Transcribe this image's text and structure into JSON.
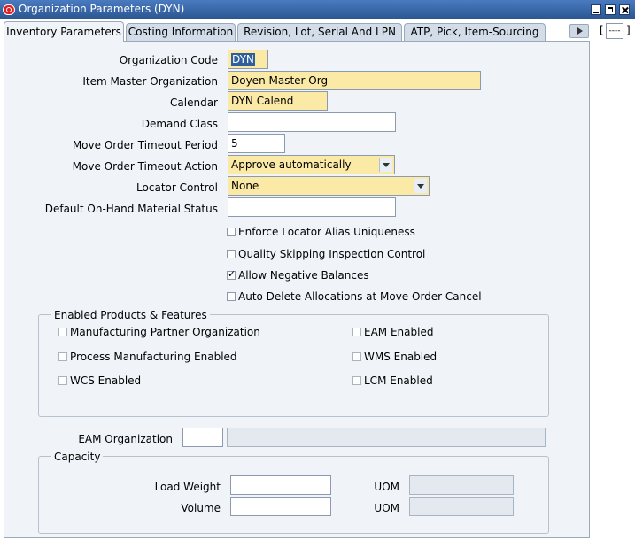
{
  "window": {
    "title": "Organization Parameters (DYN)"
  },
  "tabs": [
    {
      "label": "Inventory Parameters"
    },
    {
      "label": "Costing Information"
    },
    {
      "label": "Revision, Lot, Serial And LPN"
    },
    {
      "label": "ATP, Pick, Item-Sourcing"
    }
  ],
  "tab_extra_field": "----",
  "form": {
    "organization_code": {
      "label": "Organization Code",
      "value": "DYN"
    },
    "item_master_org": {
      "label": "Item Master Organization",
      "value": "Doyen Master Org"
    },
    "calendar": {
      "label": "Calendar",
      "value": "DYN Calend"
    },
    "demand_class": {
      "label": "Demand Class",
      "value": ""
    },
    "move_order_timeout_period": {
      "label": "Move Order Timeout Period",
      "value": "5"
    },
    "move_order_timeout_action": {
      "label": "Move Order Timeout Action",
      "value": "Approve automatically"
    },
    "locator_control": {
      "label": "Locator Control",
      "value": "None"
    },
    "default_onhand_status": {
      "label": "Default On-Hand Material Status",
      "value": ""
    }
  },
  "checkboxes": [
    {
      "label": "Enforce Locator Alias Uniqueness",
      "checked": false
    },
    {
      "label": "Quality Skipping Inspection Control",
      "checked": false
    },
    {
      "label": "Allow Negative Balances",
      "checked": true
    },
    {
      "label": "Auto Delete Allocations at Move Order Cancel",
      "checked": false
    }
  ],
  "enabled_products": {
    "title": "Enabled Products & Features",
    "items": [
      {
        "label": "Manufacturing Partner Organization",
        "checked": false
      },
      {
        "label": "EAM Enabled",
        "checked": false
      },
      {
        "label": "Process Manufacturing Enabled",
        "checked": false
      },
      {
        "label": "WMS Enabled",
        "checked": false
      },
      {
        "label": "WCS Enabled",
        "checked": false
      },
      {
        "label": "LCM Enabled",
        "checked": false
      }
    ]
  },
  "eam": {
    "label": "EAM Organization",
    "code": "",
    "name": ""
  },
  "capacity": {
    "title": "Capacity",
    "load_weight_label": "Load Weight",
    "load_weight_value": "",
    "volume_label": "Volume",
    "volume_value": "",
    "uom_label": "UOM",
    "weight_uom": "",
    "volume_uom": ""
  }
}
